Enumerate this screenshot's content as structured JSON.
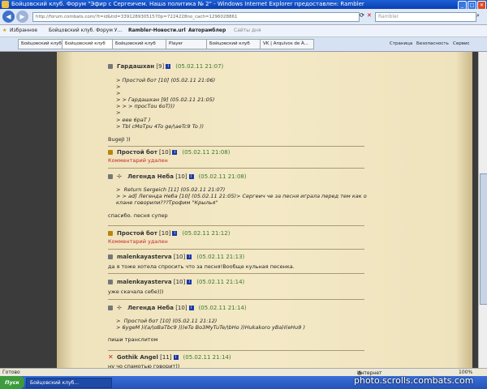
{
  "window": {
    "title": "Бойцовский клуб. Форум \"Эфир с Сергеичем. Наша политика № 2\" - Windows Internet Explorer предоставлен: Rambler"
  },
  "address": {
    "url": "http://forum.combats.com/?t=id&tid=33912893051570p=7224228no_cach=1296028861",
    "search_placeholder": "Rambler"
  },
  "favorites": {
    "label": "Избранное",
    "items": [
      "Бойцовский клуб. Форум У...",
      "Rambler-Новости.url",
      "Авторамблер",
      "Сайты дня"
    ]
  },
  "tabs": [
    "Бойцовский клуб",
    "Бойцовский клуб",
    "Бойцовский клуб",
    "Player",
    "Бойцовский клуб",
    "VK | Arquivos de À..."
  ],
  "toolbar_right": [
    "Страница",
    "Безопасность",
    "Сервис"
  ],
  "posts": [
    {
      "author": "Гардашхан",
      "level": "[9]",
      "date": "(05.02.11 21:07)",
      "quote": "> Простой бот [10] (05.02.11 21:06)\n>\n>\n> > Гардашхан [9] (05.02.11 21:05)\n> > > просТоu 6oT)))\n>\n> eee 6paT )\n> Tbl cMoTpu 4To ge/\\aeTc9 To ))",
      "text": "BugeJI ))"
    },
    {
      "author": "Простой бот",
      "level": "[10]",
      "date": "(05.02.11 21:08)",
      "text": "Комментарий удален",
      "deleted": true
    },
    {
      "author": "Легенда Неба",
      "level": "[10]",
      "date": "(05.02.11 21:08)",
      "quote": ">  Return Sergeich [11] (05.02.11 21:07)\n> > ad] Легенда Неба [10] (05.02.11 21:05)> Сергеич че за песня играла перед тем как о\nклане говорили???Трофим \"Крылья\"",
      "text": "спасибо. песня супер"
    },
    {
      "author": "Простой бот",
      "level": "[10]",
      "date": "(05.02.11 21:12)",
      "text": "Комментарий удален",
      "deleted": true
    },
    {
      "author": "malenkayasterva",
      "level": "[10]",
      "date": "(05.02.11 21:13)",
      "text": "да я тоже хотела спросить что за песня!Вообще кульная песенка."
    },
    {
      "author": "malenkayasterva",
      "level": "[10]",
      "date": "(05.02.11 21:14)",
      "text": "уже скачала себе)))"
    },
    {
      "author": "Легенда Неба",
      "level": "[10]",
      "date": "(05.02.11 21:14)",
      "quote": ">  Простой бот [10] (05.02.11 21:12)\n> 6ygeM )i(a/\\oBaTbc9 )))eTo Bo3MyTuTe/\\bHo ))Hukakoro yBa)I(eHu9 )",
      "text": "пиши транслитом"
    },
    {
      "author": "Gothik Angel",
      "level": "[11]",
      "date": "(05.02.11 21:14)",
      "text": "ну чо спамотью говорит))"
    }
  ],
  "status": {
    "left": "Готово",
    "zone": "Интернет",
    "zoom": "100%"
  },
  "taskbar": {
    "start": "Пуск",
    "task": "Бойцовский клуб..."
  },
  "watermark": "photo.scrolls.combats.com",
  "colors": {
    "title_bar": "#0a3fb0",
    "parchment": "#f4e9c6",
    "date": "#3a7a2a",
    "deleted": "#c62828",
    "info_icon": "#1a3aa8"
  }
}
